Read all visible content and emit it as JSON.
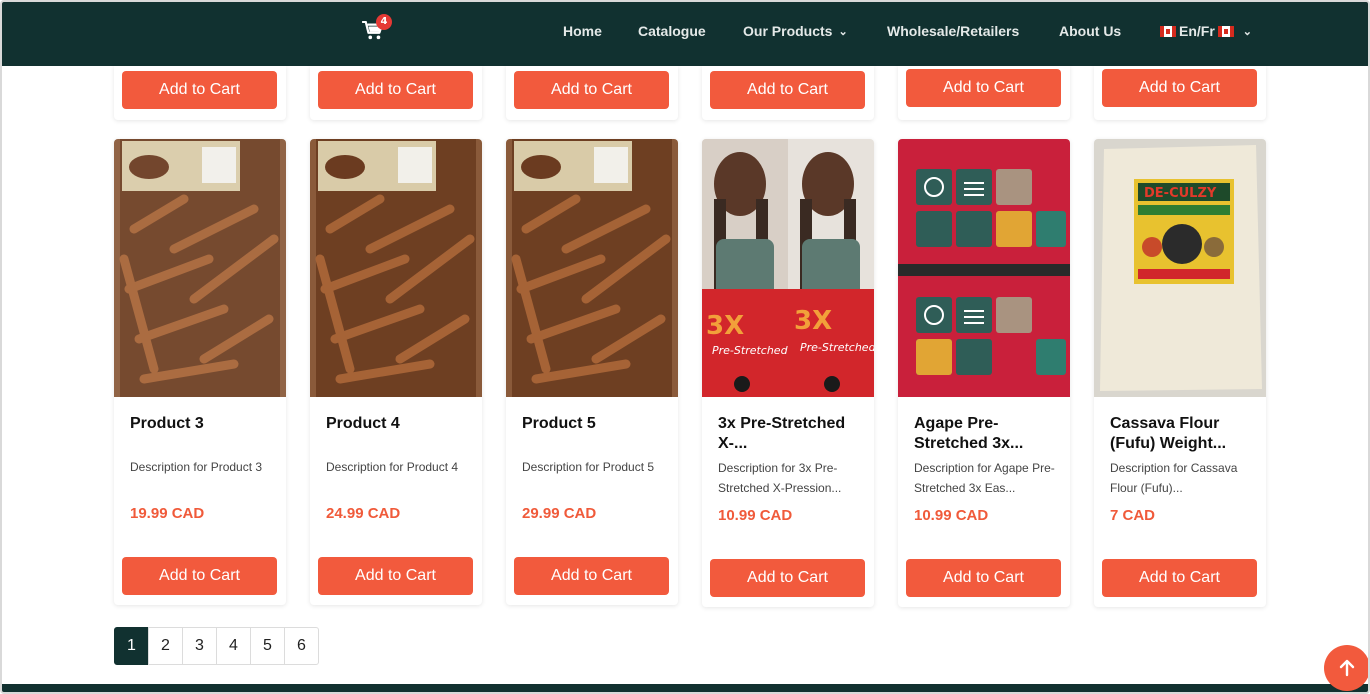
{
  "colors": {
    "nav_bg": "#113130",
    "accent": "#f25a3d",
    "price": "#f05a3a",
    "badge": "#e53935"
  },
  "header": {
    "cart_icon": "shopping-cart-icon",
    "cart_count": "4",
    "nav": {
      "home": "Home",
      "catalogue": "Catalogue",
      "our_products": "Our Products",
      "wholesale": "Wholesale/Retailers",
      "about": "About Us",
      "language": "En/Fr"
    }
  },
  "products": {
    "add_to_cart_label": "Add to Cart",
    "items": [
      {
        "title": "Product 3",
        "description": "Description for Product 3",
        "price": "19.99 CAD"
      },
      {
        "title": "Product 4",
        "description": "Description for Product 4",
        "price": "24.99 CAD"
      },
      {
        "title": "Product 5",
        "description": "Description for Product 5",
        "price": "29.99 CAD"
      },
      {
        "title": "3x Pre-Stretched X-...",
        "description": "Description for 3x Pre-Stretched X-Pression...",
        "price": "10.99 CAD"
      },
      {
        "title": "Agape Pre-Stretched 3x...",
        "description": "Description for Agape Pre-Stretched 3x Eas...",
        "price": "10.99 CAD"
      },
      {
        "title": "Cassava Flour (Fufu) Weight...",
        "description": "Description for Cassava Flour (Fufu)...",
        "price": "7 CAD"
      }
    ]
  },
  "pagination": {
    "pages": [
      "1",
      "2",
      "3",
      "4",
      "5",
      "6"
    ],
    "current": "1"
  },
  "scroll_top_icon": "arrow-up-icon"
}
